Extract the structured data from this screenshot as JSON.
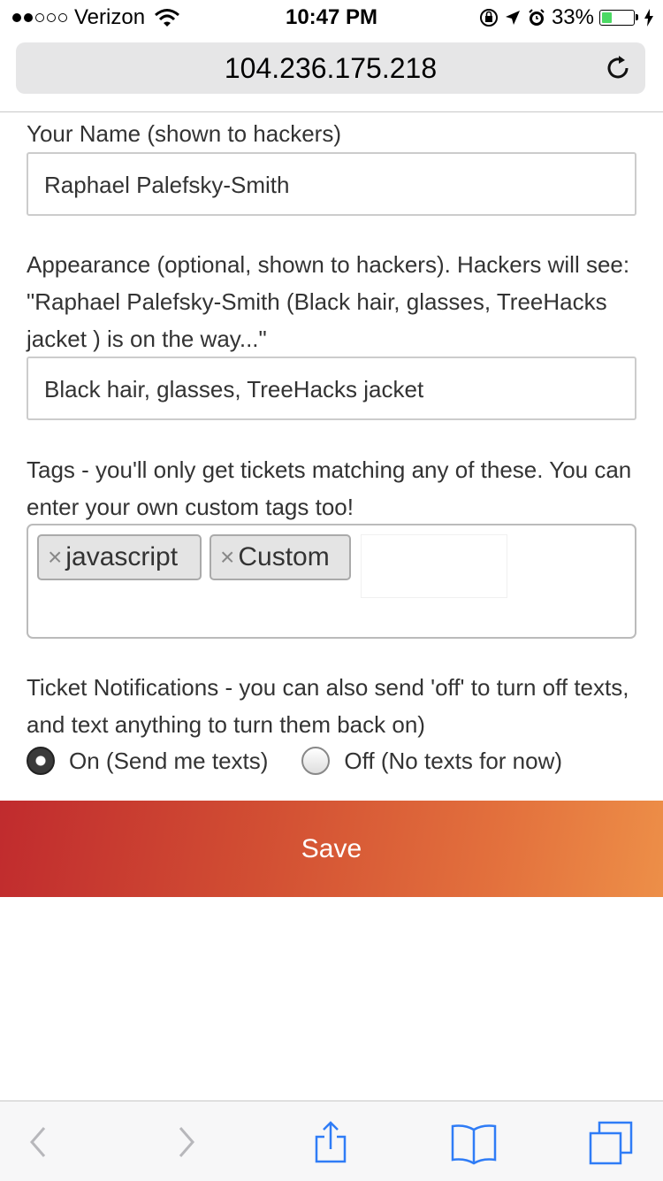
{
  "status_bar": {
    "carrier": "Verizon",
    "time": "10:47 PM",
    "battery": "33%",
    "battery_level": 0.33,
    "signal_bars_filled": 2,
    "signal_bars_total": 5
  },
  "browser": {
    "url": "104.236.175.218"
  },
  "form": {
    "name_label": "Your Name (shown to hackers)",
    "name_value": "Raphael Palefsky-Smith",
    "appearance_label": "Appearance (optional, shown to hackers). Hackers will see: \"Raphael Palefsky-Smith (Black hair, glasses, TreeHacks jacket ) is on the way...\"",
    "appearance_value": "Black hair, glasses, TreeHacks jacket",
    "tags_label": "Tags - you'll only get tickets matching any of these. You can enter your own custom tags too!",
    "tags": [
      {
        "remove": "×",
        "label": "javascript"
      },
      {
        "remove": "×",
        "label": "Custom"
      }
    ],
    "notifications_label": "Ticket Notifications - you can also send 'off' to turn off texts, and text anything to turn them back on)",
    "option_on": "On (Send me texts)",
    "option_off": "Off (No texts for now)",
    "selected_option": "on",
    "save_label": "Save"
  },
  "colors": {
    "save_gradient_start": "#c02b2e",
    "save_gradient_end": "#ed8f48",
    "ios_blue": "#2f7cf6",
    "battery_green": "#4cd964"
  },
  "icons": {
    "reload": "reload-icon",
    "back": "back-arrow-icon",
    "forward": "forward-arrow-icon",
    "share": "share-icon",
    "bookmarks": "bookmarks-icon",
    "tabs": "tabs-icon"
  }
}
